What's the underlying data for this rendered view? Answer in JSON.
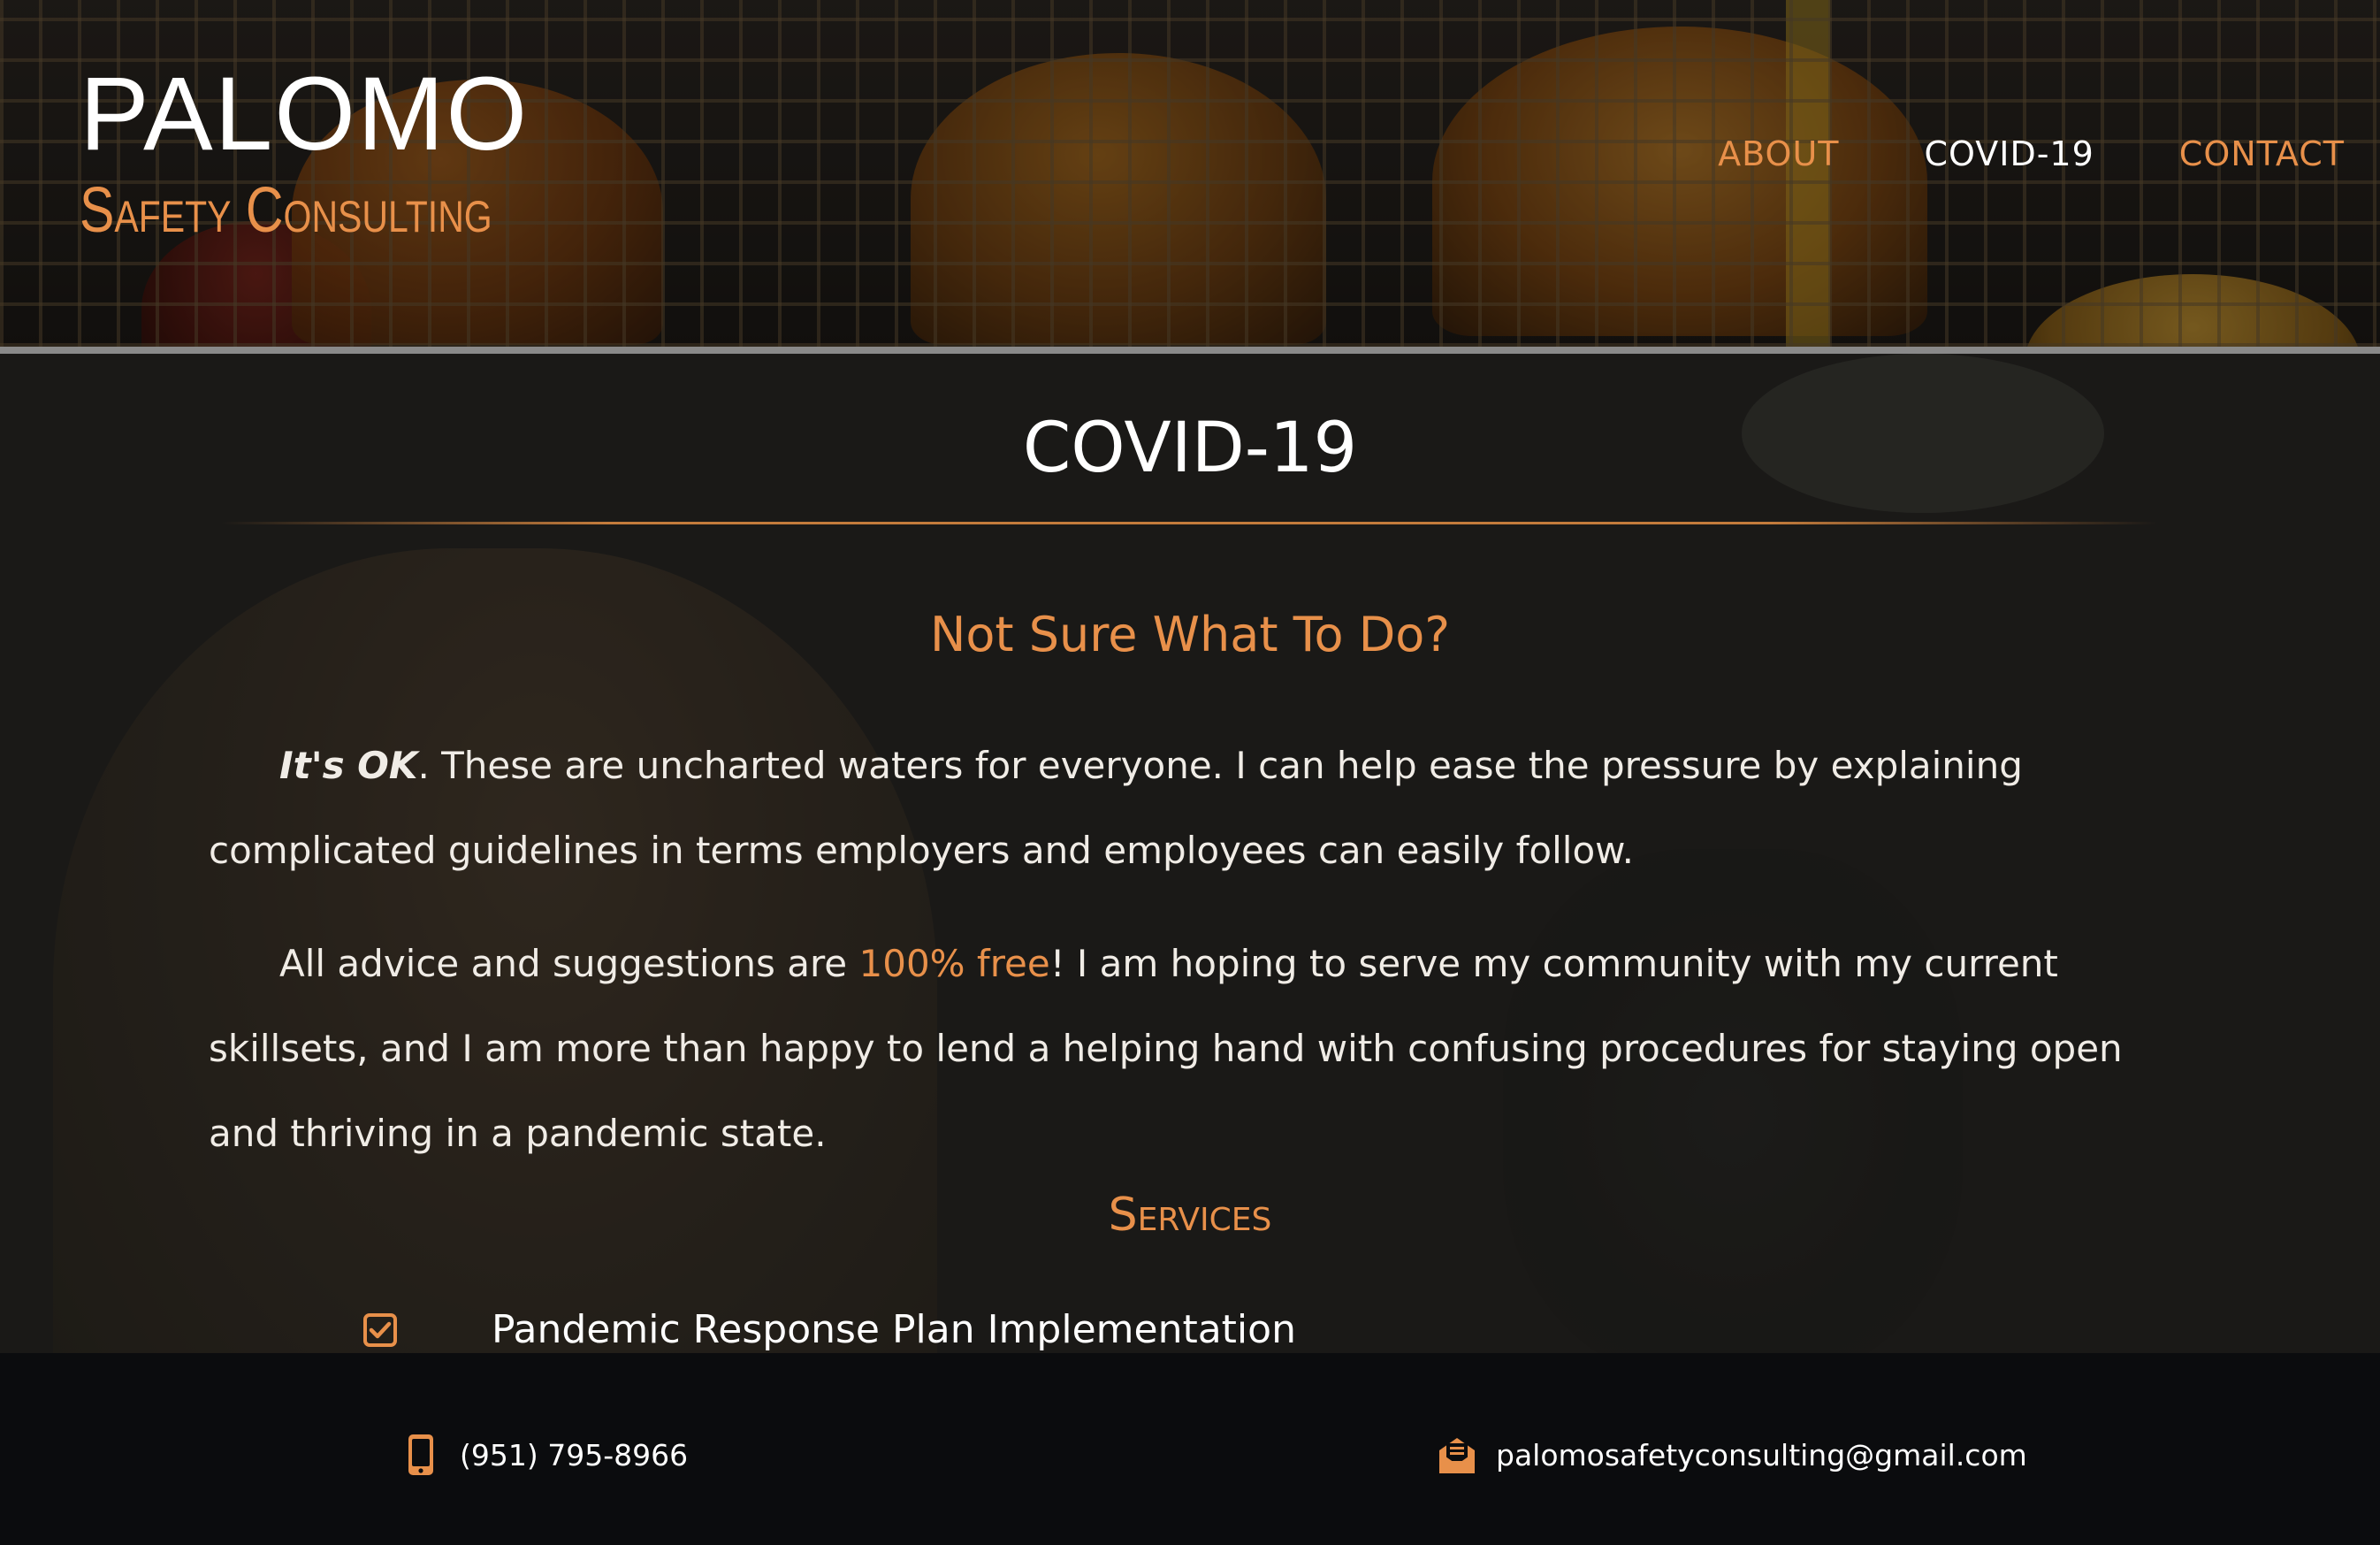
{
  "brand": {
    "name": "PALOMO",
    "tagline": "Safety Consulting"
  },
  "nav": {
    "items": [
      {
        "label": "ABOUT",
        "active": false
      },
      {
        "label": "COVID-19",
        "active": true
      },
      {
        "label": "CONTACT",
        "active": false
      }
    ]
  },
  "main": {
    "title": "COVID-19",
    "subheading": "Not Sure What To Do?",
    "paragraph1": {
      "emphasis": "It's OK",
      "text": ". These are uncharted waters for everyone. I can help ease the pressure by explaining complicated guidelines in terms employers and employees can easily follow."
    },
    "paragraph2": {
      "before": "All advice and suggestions are ",
      "highlight": "100% free",
      "after": "! I am hoping to serve my community with my current skillsets, and I am more than happy to lend a helping hand with confusing procedures for staying open and thriving in a pandemic state."
    },
    "services_title": "Services",
    "services": [
      {
        "label": "Pandemic Response Plan Implementation",
        "icon": "checkbox-checked-icon"
      }
    ]
  },
  "footer": {
    "phone": {
      "icon": "mobile-phone-icon",
      "text": "(951) 795-8966"
    },
    "email": {
      "icon": "envelope-open-icon",
      "text": "palomosafetyconsulting@gmail.com"
    }
  },
  "colors": {
    "accent": "#e8904a",
    "text": "#ffffff",
    "footer_bg": "#0b0c0e"
  }
}
